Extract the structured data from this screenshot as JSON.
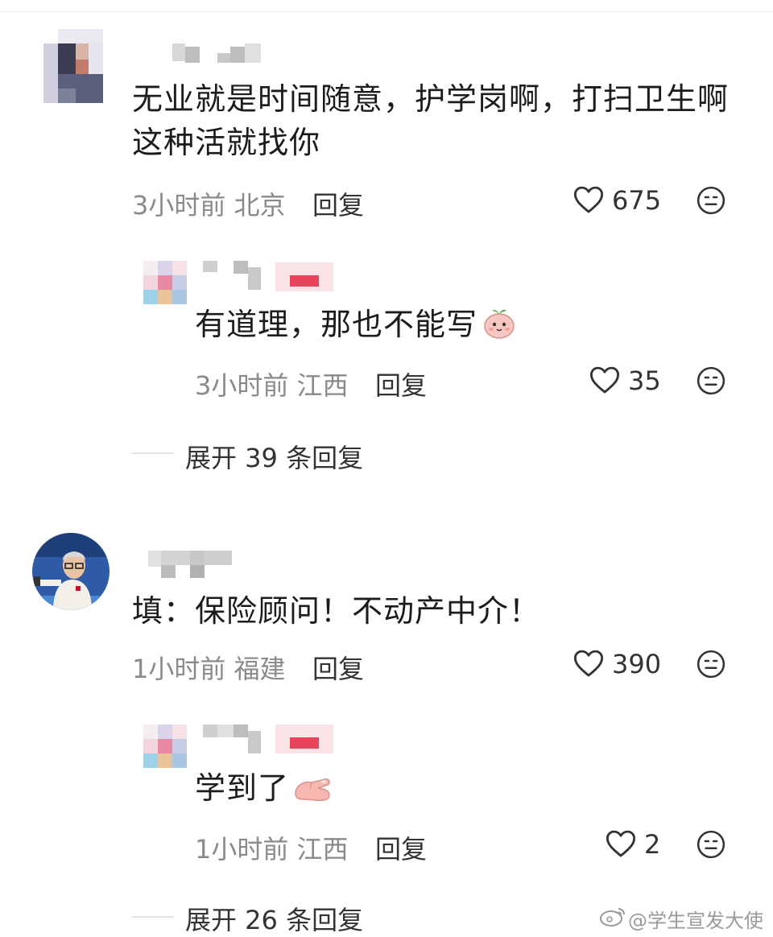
{
  "comments": [
    {
      "text": "无业就是时间随意，护学岗啊，打扫卫生啊这种活就找你",
      "time_location": "3小时前 北京",
      "reply_label": "回复",
      "likes": "675",
      "reply": {
        "text": "有道理，那也不能写",
        "time_location": "3小时前 江西",
        "reply_label": "回复",
        "likes": "35"
      },
      "expand_label": "展开 39 条回复"
    },
    {
      "text": "填：保险顾问！不动产中介！",
      "time_location": "1小时前 福建",
      "reply_label": "回复",
      "likes": "390",
      "reply": {
        "text": "学到了",
        "time_location": "1小时前 江西",
        "reply_label": "回复",
        "likes": "2"
      },
      "expand_label": "展开 26 条回复"
    }
  ],
  "watermark": "@学生宣发大使",
  "icons": {
    "like": "heart-outline-icon",
    "dislike": "meh-face-icon",
    "emoji1": "peach-face-emoji",
    "emoji2": "pinching-hand-emoji",
    "brand": "weibo-logo-icon"
  },
  "colors": {
    "text": "#1c1c1c",
    "meta": "#8a8a8a",
    "badge": "#e8435a"
  }
}
